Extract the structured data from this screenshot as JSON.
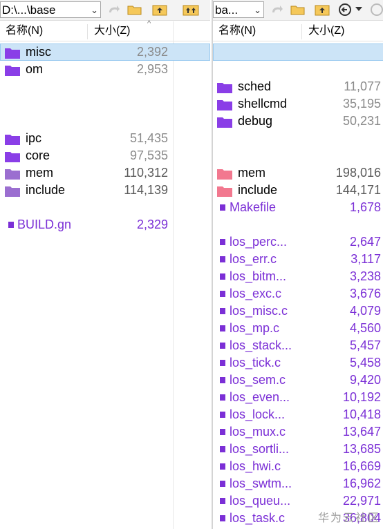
{
  "left": {
    "path": "D:\\...\\base",
    "col_name": "名称(N)",
    "col_size": "大小(Z)",
    "rows": [
      {
        "name": "misc",
        "size": "2,392",
        "type": "folder",
        "selected": true
      },
      {
        "name": "om",
        "size": "2,953",
        "type": "folder"
      },
      {
        "name": "",
        "size": "",
        "type": "empty"
      },
      {
        "name": "",
        "size": "",
        "type": "empty"
      },
      {
        "name": "",
        "size": "",
        "type": "empty"
      },
      {
        "name": "ipc",
        "size": "51,435",
        "type": "folder"
      },
      {
        "name": "core",
        "size": "97,535",
        "type": "folder"
      },
      {
        "name": "mem",
        "size": "110,312",
        "type": "folder-alt"
      },
      {
        "name": "include",
        "size": "114,139",
        "type": "folder-alt"
      },
      {
        "name": "",
        "size": "",
        "type": "empty"
      },
      {
        "name": "BUILD.gn",
        "size": "2,329",
        "type": "file"
      }
    ]
  },
  "right": {
    "path": "ba...",
    "col_name": "名称(N)",
    "col_size": "大小(Z)",
    "rows": [
      {
        "name": "",
        "size": "",
        "type": "empty",
        "selected": true
      },
      {
        "name": "",
        "size": "",
        "type": "empty"
      },
      {
        "name": "sched",
        "size": "11,077",
        "type": "folder"
      },
      {
        "name": "shellcmd",
        "size": "35,195",
        "type": "folder"
      },
      {
        "name": "debug",
        "size": "50,231",
        "type": "folder"
      },
      {
        "name": "",
        "size": "",
        "type": "empty"
      },
      {
        "name": "",
        "size": "",
        "type": "empty"
      },
      {
        "name": "mem",
        "size": "198,016",
        "type": "folder-red"
      },
      {
        "name": "include",
        "size": "144,171",
        "type": "folder-red"
      },
      {
        "name": "Makefile",
        "size": "1,678",
        "type": "file"
      },
      {
        "name": "",
        "size": "",
        "type": "empty"
      },
      {
        "name": "los_perc...",
        "size": "2,647",
        "type": "file"
      },
      {
        "name": "los_err.c",
        "size": "3,117",
        "type": "file"
      },
      {
        "name": "los_bitm...",
        "size": "3,238",
        "type": "file"
      },
      {
        "name": "los_exc.c",
        "size": "3,676",
        "type": "file"
      },
      {
        "name": "los_misc.c",
        "size": "4,079",
        "type": "file"
      },
      {
        "name": "los_mp.c",
        "size": "4,560",
        "type": "file"
      },
      {
        "name": "los_stack...",
        "size": "5,457",
        "type": "file"
      },
      {
        "name": "los_tick.c",
        "size": "5,458",
        "type": "file"
      },
      {
        "name": "los_sem.c",
        "size": "9,420",
        "type": "file"
      },
      {
        "name": "los_even...",
        "size": "10,192",
        "type": "file"
      },
      {
        "name": "los_lock...",
        "size": "10,418",
        "type": "file"
      },
      {
        "name": "los_mux.c",
        "size": "13,647",
        "type": "file"
      },
      {
        "name": "los_sortli...",
        "size": "13,685",
        "type": "file"
      },
      {
        "name": "los_hwi.c",
        "size": "16,669",
        "type": "file"
      },
      {
        "name": "los_swtm...",
        "size": "16,962",
        "type": "file"
      },
      {
        "name": "los_queu...",
        "size": "22,971",
        "type": "file"
      },
      {
        "name": "los_task.c",
        "size": "36,804",
        "type": "file"
      }
    ]
  },
  "watermark": "华为云社区",
  "icons": {
    "folder_color": "#8a3ee6",
    "folder_alt_color": "#9b6fd0",
    "folder_red_color": "#f2788f",
    "file_color": "#7b2fd6"
  }
}
